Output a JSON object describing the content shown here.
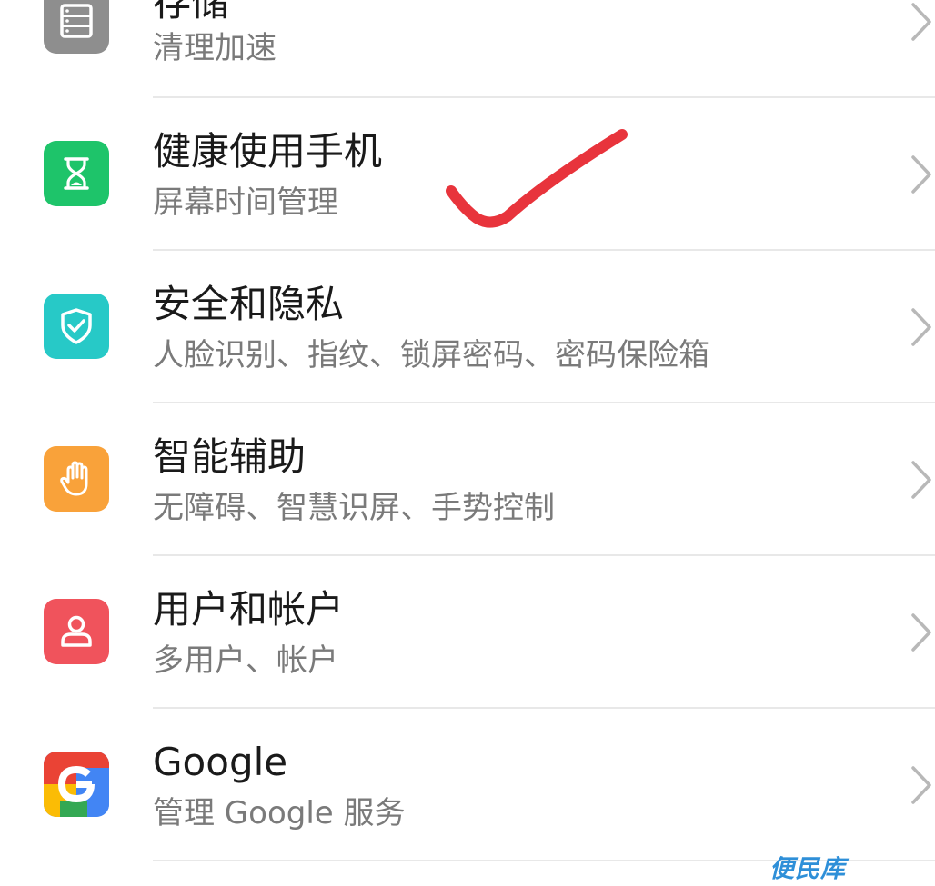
{
  "settings": {
    "items": [
      {
        "title": "存储",
        "subtitle": "清理加速",
        "icon": "storage-icon",
        "color": "#8e8e8e"
      },
      {
        "title": "健康使用手机",
        "subtitle": "屏幕时间管理",
        "icon": "hourglass-icon",
        "color": "#1ec46a"
      },
      {
        "title": "安全和隐私",
        "subtitle": "人脸识别、指纹、锁屏密码、密码保险箱",
        "icon": "shield-check-icon",
        "color": "#27c9c7"
      },
      {
        "title": "智能辅助",
        "subtitle": "无障碍、智慧识屏、手势控制",
        "icon": "hand-icon",
        "color": "#f9a23a"
      },
      {
        "title": "用户和帐户",
        "subtitle": "多用户、帐户",
        "icon": "user-icon",
        "color": "#f0535c"
      },
      {
        "title": "Google",
        "subtitle": "管理 Google 服务",
        "icon": "google-icon",
        "color": "#4285f4"
      }
    ]
  },
  "annotation": {
    "icon": "checkmark-annotation",
    "color": "#e8343c"
  },
  "watermark": {
    "text": "便民库",
    "color": "#2e8fd8"
  }
}
